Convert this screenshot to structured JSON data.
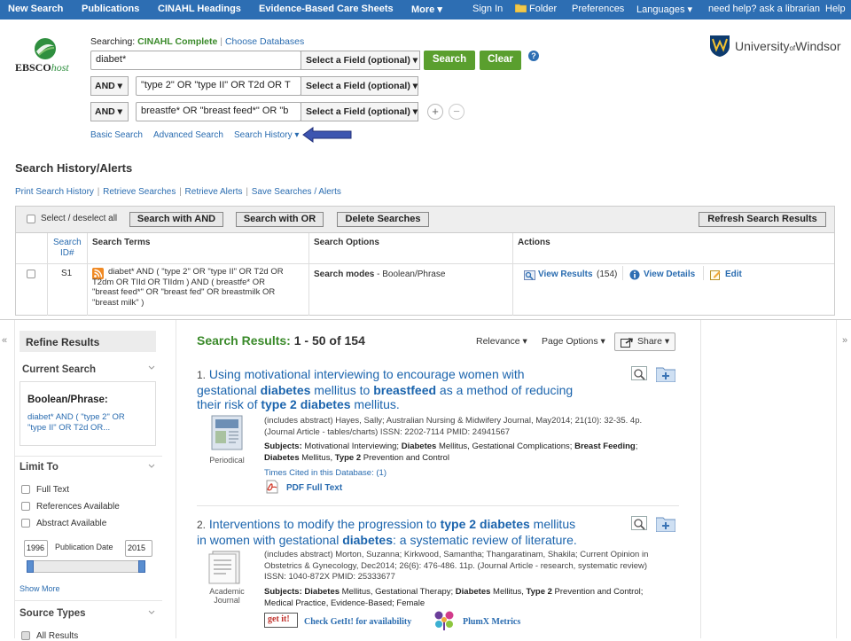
{
  "topnav": {
    "new_search": "New Search",
    "publications": "Publications",
    "cinahl_headings": "CINAHL Headings",
    "ebcs": "Evidence-Based Care Sheets",
    "more": "More ▾",
    "sign_in": "Sign In",
    "folder": "Folder",
    "preferences": "Preferences",
    "languages": "Languages ▾",
    "help_librarian": "need help? ask a librarian",
    "help": "Help"
  },
  "logo": {
    "ebsco": "EBSCO",
    "host": "host"
  },
  "institution": {
    "name_a": "University",
    "name_of": "of",
    "name_b": "Windsor"
  },
  "searching": {
    "label": "Searching:",
    "db": "CINAHL Complete",
    "choose": "Choose Databases"
  },
  "search": {
    "row1": {
      "value": "diabet*",
      "field": "Select a Field (optional) ▾"
    },
    "row2": {
      "op": "AND ▾",
      "value": "\"type 2\" OR \"type II\" OR T2d OR T",
      "field": "Select a Field (optional) ▾"
    },
    "row3": {
      "op": "AND ▾",
      "value": "breastfe* OR \"breast feed*\" OR \"b",
      "field": "Select a Field (optional) ▾"
    },
    "search_btn": "Search",
    "clear_btn": "Clear",
    "help_q": "?",
    "add": "+",
    "remove": "−"
  },
  "search_links": {
    "basic": "Basic Search",
    "advanced": "Advanced Search",
    "history": "Search History ▾"
  },
  "history": {
    "title": "Search History/Alerts",
    "links": [
      "Print Search History",
      "Retrieve Searches",
      "Retrieve Alerts",
      "Save Searches / Alerts"
    ],
    "select_all": "Select / deselect all",
    "with_and": "Search with AND",
    "with_or": "Search with OR",
    "delete": "Delete Searches",
    "refresh": "Refresh Search Results",
    "col_id_a": "Search",
    "col_id_b": "ID#",
    "col_terms": "Search Terms",
    "col_options": "Search Options",
    "col_actions": "Actions",
    "row": {
      "id": "S1",
      "terms_lines": [
        "diabet* AND ( \"type 2\" OR \"type II\" OR T2d OR",
        "T2dm OR TIId OR TIIdm ) AND ( breastfe* OR",
        "\"breast feed*\" OR \"breast fed\" OR breastmilk OR",
        "\"breast milk\" )"
      ],
      "modes_label": "Search modes",
      "modes_value": " - Boolean/Phrase",
      "view_results": "View Results",
      "count": "(154)",
      "view_details": "View Details",
      "edit": "Edit"
    }
  },
  "sidebar": {
    "collapse_left": "«",
    "collapse_right": "»",
    "refine": "Refine Results",
    "current_search": "Current Search",
    "bool_label": "Boolean/Phrase:",
    "bool_text_1": "diabet* AND ( \"type 2\" OR",
    "bool_text_2": "\"type II\" OR T2d OR...",
    "limit_to": "Limit To",
    "limits": [
      "Full Text",
      "References Available",
      "Abstract Available"
    ],
    "date_from": "1996",
    "date_label": "Publication Date",
    "date_to": "2015",
    "show_more": "Show More",
    "source_types": "Source Types",
    "all_results": "All Results"
  },
  "results": {
    "header_label": "Search Results:",
    "header_range": " 1 - 50 of 154",
    "relevance": "Relevance ▾",
    "page_options": "Page Options ▾",
    "share": "Share ▾",
    "items": [
      {
        "num": "1.",
        "t1": " Using motivational interviewing to encourage women with",
        "t2a": "gestational ",
        "t2b": "diabetes",
        "t2c": " mellitus to ",
        "t2d": "breastfeed",
        "t2e": " as a method of reducing",
        "t3a": "their risk of ",
        "t3b": "type 2 diabetes",
        "t3c": " mellitus.",
        "meta1": "(includes abstract) Hayes, Sally; Australian Nursing & Midwifery Journal, May2014; 21(10): 32-35. 4p.",
        "meta2": "(Journal Article - tables/charts) ISSN: 2202-7114 PMID: 24941567",
        "subj_label": "Subjects:",
        "subj_a": " Motivational Interviewing; ",
        "subj_b": "Diabetes",
        "subj_c": " Mellitus, Gestational Complications; ",
        "subj_d": "Breast Feeding",
        "subj_e": ";",
        "subj2_a": "Diabetes",
        "subj2_b": " Mellitus, ",
        "subj2_c": "Type 2",
        "subj2_d": " Prevention and Control",
        "cited": "Times Cited in this Database: (1)",
        "pdf": "PDF Full Text",
        "ptype": "Periodical"
      },
      {
        "num": "2.",
        "t1a": " Interventions to modify the progression to ",
        "t1b": "type 2 diabetes",
        "t1c": " mellitus",
        "t2a": "in women with gestational ",
        "t2b": "diabetes",
        "t2c": ": a systematic review of literature.",
        "meta1": "(includes abstract) Morton, Suzanna; Kirkwood, Samantha; Thangaratinam, Shakila; Current Opinion in",
        "meta2": "Obstetrics & Gynecology, Dec2014; 26(6): 476-486. 11p. (Journal Article - research, systematic review)",
        "meta3": "ISSN: 1040-872X PMID: 25333677",
        "subj_label": "Subjects:",
        "subj_a": " ",
        "subj_b": "Diabetes",
        "subj_c": " Mellitus, Gestational Therapy; ",
        "subj_d": "Diabetes",
        "subj_e": " Mellitus, ",
        "subj_f": "Type 2",
        "subj_g": " Prevention and Control;",
        "subj2": "Medical Practice, Evidence-Based; Female",
        "getit_logo": "get it!",
        "getit": "Check GetIt! for availability",
        "plumx": "PlumX Metrics",
        "ptype_a": "Academic",
        "ptype_b": "Journal"
      }
    ]
  },
  "colors": {
    "topnav": "#2d6eb3",
    "green": "#5a9f2e",
    "link": "#2a6cb0",
    "result_header": "#3a8a2a",
    "arrow": "#3d55b0"
  }
}
